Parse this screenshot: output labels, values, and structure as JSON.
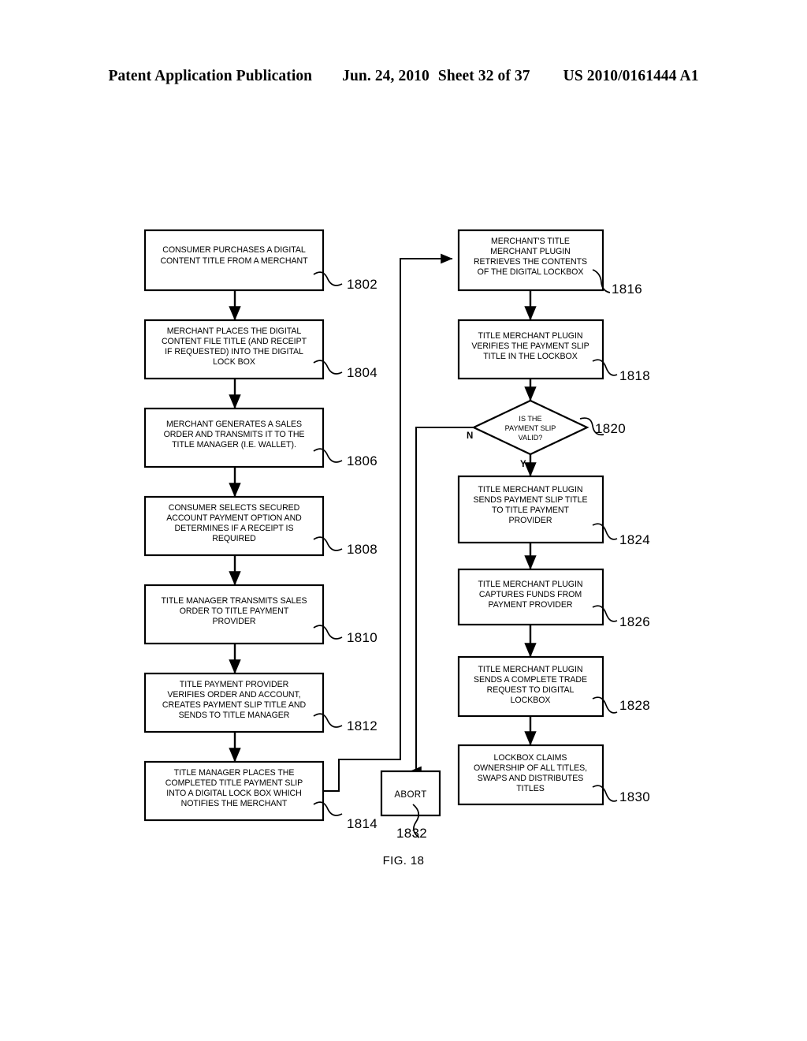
{
  "header": {
    "publication": "Patent Application Publication",
    "date": "Jun. 24, 2010",
    "sheet": "Sheet 32 of 37",
    "number": "US 2010/0161444 A1"
  },
  "figure": {
    "caption": "FIG. 18",
    "type": "flowchart",
    "colors": {
      "ink": "#000000",
      "paper": "#ffffff"
    }
  },
  "nodes": [
    {
      "id": "1802",
      "ref": "1802",
      "shape": "rect",
      "column": "left",
      "lines": [
        "CONSUMER PURCHASES A DIGITAL",
        "CONTENT TITLE FROM A MERCHANT"
      ]
    },
    {
      "id": "1804",
      "ref": "1804",
      "shape": "rect",
      "column": "left",
      "lines": [
        "MERCHANT PLACES THE DIGITAL",
        "CONTENT FILE TITLE (AND RECEIPT",
        "IF REQUESTED) INTO THE DIGITAL",
        "LOCK BOX"
      ]
    },
    {
      "id": "1806",
      "ref": "1806",
      "shape": "rect",
      "column": "left",
      "lines": [
        "MERCHANT  GENERATES A SALES",
        "ORDER AND TRANSMITS IT TO THE",
        "TITLE MANAGER (I.E. WALLET)."
      ]
    },
    {
      "id": "1808",
      "ref": "1808",
      "shape": "rect",
      "column": "left",
      "lines": [
        "CONSUMER SELECTS SECURED",
        "ACCOUNT PAYMENT OPTION AND",
        "DETERMINES IF A RECEIPT IS",
        "REQUIRED"
      ]
    },
    {
      "id": "1810",
      "ref": "1810",
      "shape": "rect",
      "column": "left",
      "lines": [
        "TITLE MANAGER TRANSMITS SALES",
        "ORDER TO TITLE PAYMENT",
        "PROVIDER"
      ]
    },
    {
      "id": "1812",
      "ref": "1812",
      "shape": "rect",
      "column": "left",
      "lines": [
        "TITLE PAYMENT PROVIDER",
        "VERIFIES ORDER AND ACCOUNT,",
        "CREATES PAYMENT SLIP TITLE AND",
        "SENDS TO TITLE MANAGER"
      ]
    },
    {
      "id": "1814",
      "ref": "1814",
      "shape": "rect",
      "column": "left",
      "lines": [
        "TITLE MANAGER PLACES THE",
        "COMPLETED TITLE PAYMENT SLIP",
        "INTO A DIGITAL LOCK BOX WHICH",
        "NOTIFIES THE MERCHANT"
      ]
    },
    {
      "id": "1832",
      "ref": "1832",
      "shape": "rect",
      "column": "center",
      "lines": [
        "ABORT"
      ]
    },
    {
      "id": "1816",
      "ref": "1816",
      "shape": "rect",
      "column": "right",
      "lines": [
        "MERCHANT'S TITLE",
        "MERCHANT PLUGIN",
        "RETRIEVES THE CONTENTS",
        "OF THE DIGITAL LOCKBOX"
      ]
    },
    {
      "id": "1818",
      "ref": "1818",
      "shape": "rect",
      "column": "right",
      "lines": [
        "TITLE MERCHANT PLUGIN",
        "VERIFIES THE PAYMENT SLIP",
        "TITLE IN THE LOCKBOX"
      ]
    },
    {
      "id": "1820",
      "ref": "1820",
      "shape": "diamond",
      "column": "right",
      "lines": [
        "IS THE",
        "PAYMENT SLIP",
        "VALID?"
      ]
    },
    {
      "id": "1824",
      "ref": "1824",
      "shape": "rect",
      "column": "right",
      "lines": [
        "TITLE MERCHANT PLUGIN",
        "SENDS PAYMENT SLIP TITLE",
        "TO TITLE PAYMENT",
        "PROVIDER"
      ]
    },
    {
      "id": "1826",
      "ref": "1826",
      "shape": "rect",
      "column": "right",
      "lines": [
        "TITLE MERCHANT PLUGIN",
        "CAPTURES FUNDS FROM",
        "PAYMENT PROVIDER"
      ]
    },
    {
      "id": "1828",
      "ref": "1828",
      "shape": "rect",
      "column": "right",
      "lines": [
        "TITLE MERCHANT PLUGIN",
        "SENDS A COMPLETE TRADE",
        "REQUEST TO DIGITAL",
        "LOCKBOX"
      ]
    },
    {
      "id": "1830",
      "ref": "1830",
      "shape": "rect",
      "column": "right",
      "lines": [
        "LOCKBOX CLAIMS",
        "OWNERSHIP OF ALL TITLES,",
        "SWAPS AND DISTRIBUTES",
        "TITLES"
      ]
    }
  ],
  "branch_labels": {
    "no": "N",
    "yes": "Y"
  },
  "edges": [
    {
      "from": "1802",
      "to": "1804",
      "label": ""
    },
    {
      "from": "1804",
      "to": "1806",
      "label": ""
    },
    {
      "from": "1806",
      "to": "1808",
      "label": ""
    },
    {
      "from": "1808",
      "to": "1810",
      "label": ""
    },
    {
      "from": "1810",
      "to": "1812",
      "label": ""
    },
    {
      "from": "1812",
      "to": "1814",
      "label": ""
    },
    {
      "from": "1814",
      "to": "1816",
      "label": ""
    },
    {
      "from": "1816",
      "to": "1818",
      "label": ""
    },
    {
      "from": "1818",
      "to": "1820",
      "label": ""
    },
    {
      "from": "1820",
      "to": "1824",
      "label": "Y"
    },
    {
      "from": "1820",
      "to": "1832",
      "label": "N"
    },
    {
      "from": "1824",
      "to": "1826",
      "label": ""
    },
    {
      "from": "1826",
      "to": "1828",
      "label": ""
    },
    {
      "from": "1828",
      "to": "1830",
      "label": ""
    }
  ]
}
